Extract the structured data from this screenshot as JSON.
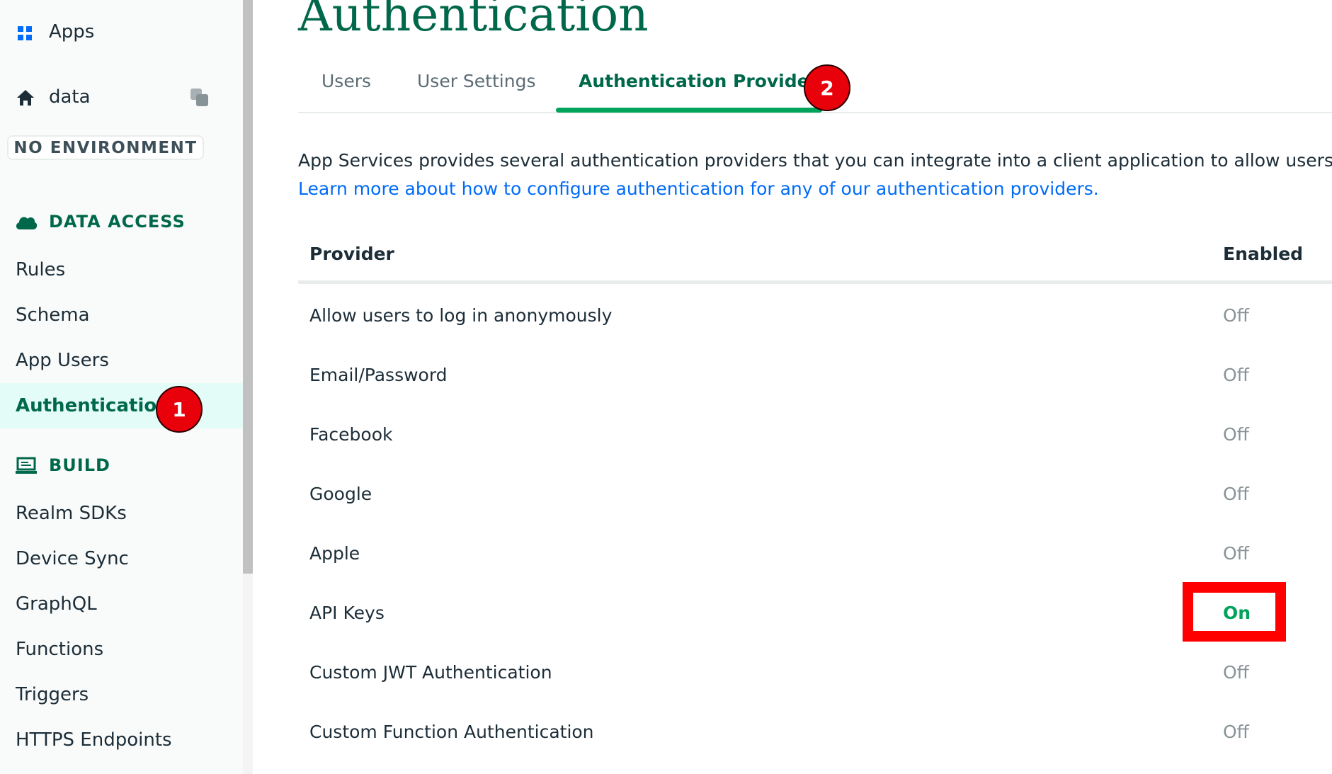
{
  "sidebar": {
    "apps_label": "Apps",
    "app_name": "data",
    "environment": "NO ENVIRONMENT",
    "sections": [
      {
        "title": "DATA ACCESS",
        "items": [
          "Rules",
          "Schema",
          "App Users",
          "Authentication"
        ]
      },
      {
        "title": "BUILD",
        "items": [
          "Realm SDKs",
          "Device Sync",
          "GraphQL",
          "Functions",
          "Triggers",
          "HTTPS Endpoints"
        ]
      }
    ],
    "active_item": "Authentication"
  },
  "main": {
    "title": "Authentication",
    "tabs": [
      {
        "label": "Users",
        "active": false
      },
      {
        "label": "User Settings",
        "active": false
      },
      {
        "label": "Authentication Providers",
        "active": true
      }
    ],
    "description": "App Services provides several authentication providers that you can integrate into a client application to allow users to",
    "learn_more_link": "Learn more about how to configure authentication for any of our authentication providers.",
    "table": {
      "headers": {
        "provider": "Provider",
        "enabled": "Enabled"
      },
      "rows": [
        {
          "provider": "Allow users to log in anonymously",
          "enabled": "Off"
        },
        {
          "provider": "Email/Password",
          "enabled": "Off"
        },
        {
          "provider": "Facebook",
          "enabled": "Off"
        },
        {
          "provider": "Google",
          "enabled": "Off"
        },
        {
          "provider": "Apple",
          "enabled": "Off"
        },
        {
          "provider": "API Keys",
          "enabled": "On"
        },
        {
          "provider": "Custom JWT Authentication",
          "enabled": "Off"
        },
        {
          "provider": "Custom Function Authentication",
          "enabled": "Off"
        }
      ]
    }
  },
  "annotations": {
    "step1": "1",
    "step2": "2"
  },
  "icons": {
    "apps": "grid-icon",
    "app_home": "home-icon",
    "copy": "copy-icon",
    "data_access": "cloud-icon",
    "build": "laptop-icon"
  },
  "colors": {
    "brand_green": "#00684a",
    "accent_green": "#00a35c",
    "link_blue": "#016bf8",
    "badge_red": "#e8000b",
    "highlight_red": "#ff0000"
  }
}
